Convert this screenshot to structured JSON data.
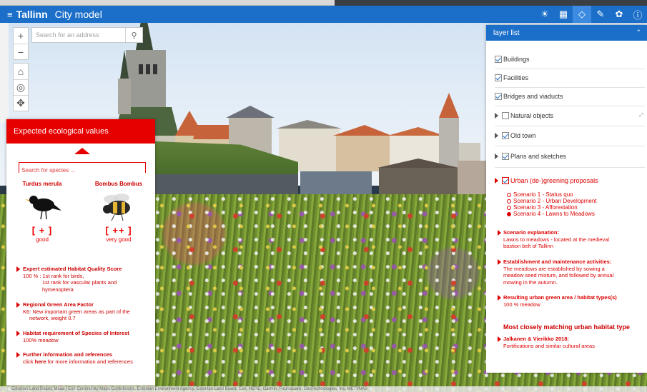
{
  "app": {
    "brand_name": "Tallinn",
    "product_name": "City model",
    "toolbar_icons": [
      "sun-icon",
      "grid-icon",
      "layers-icon",
      "pencil-icon",
      "sprout-icon",
      "info-icon"
    ],
    "accent": "#1c6fc9",
    "eco_accent": "#e60000"
  },
  "map": {
    "search_placeholder": "Search for an address",
    "attribution": "Estonian Land Board, Maaa | Esri Community Maps Contributors, Estonian Environment Agency, Estonian Land Board, Esri, HERE, Garmin, Foursquare, GeoTechnologies, Inc, METI/NAS"
  },
  "eco_panel": {
    "title": "Expected ecological values",
    "search_placeholder": "Search for species ...",
    "species": [
      {
        "name": "Turdus merula",
        "rating": "[ + ]",
        "quality": "good"
      },
      {
        "name": "Bombus Bombus",
        "rating": "[ ++ ]",
        "quality": "very good"
      }
    ],
    "habitat_score": {
      "title": "Expert estimated Habitat Quality Score",
      "line1": "100 % : 1st rank for birds,",
      "line2": "1st rank for vascular plants and",
      "line3": "hymenoptera"
    },
    "green_factor": {
      "title": "Regional Green Area Factor",
      "line1": "K6: New important green areas as part of the",
      "line2": "network, weight 0.7"
    },
    "habitat_req": {
      "title": "Habitat requirement of Species of Interest",
      "line1": "100% meadow"
    },
    "further": {
      "title": "Further information and references",
      "pre": "click ",
      "link": "here",
      "post": " for more information and references"
    }
  },
  "layer_panel": {
    "title": "layer list",
    "layers": [
      {
        "label": "Buildings",
        "checked": true
      },
      {
        "label": "Facilities",
        "checked": true
      },
      {
        "label": "Bridges and viaducts",
        "checked": true
      },
      {
        "label": "Natural objects",
        "checked": false
      },
      {
        "label": "Old town",
        "checked": true
      },
      {
        "label": "Plans and sketches",
        "checked": true
      },
      {
        "label": "Urban (de-)greening proposals",
        "checked": true
      }
    ],
    "scenarios": [
      {
        "label": "Scenario 1 - Status quo",
        "selected": false
      },
      {
        "label": "Scenario 2 - Urban Development",
        "selected": false
      },
      {
        "label": "Scenario 3 - Afforestation",
        "selected": false
      },
      {
        "label": "Scenario 4 - Lawns to Meadows",
        "selected": true
      }
    ],
    "explanation": {
      "title": "Scenario explanation:",
      "line1": "Lawns to meadows - located at the medieval",
      "line2": "bastion belt of Tallinn"
    },
    "establishment": {
      "title": "Establishment and maintenance activities:",
      "line1": "The meadows are established by sowing a",
      "line2": "meadow seed mixture, and followed by annual",
      "line3": "mowing in the autumn."
    },
    "resulting": {
      "title": "Resulting urban green area / habitat types(s)",
      "line1": "100 % meadow"
    },
    "matching_title": "Most closely matching urban habitat type",
    "matching": {
      "title": "Jalkanen & Vierikko 2018:",
      "line1": "Fortifications and similar cultural areas"
    }
  }
}
